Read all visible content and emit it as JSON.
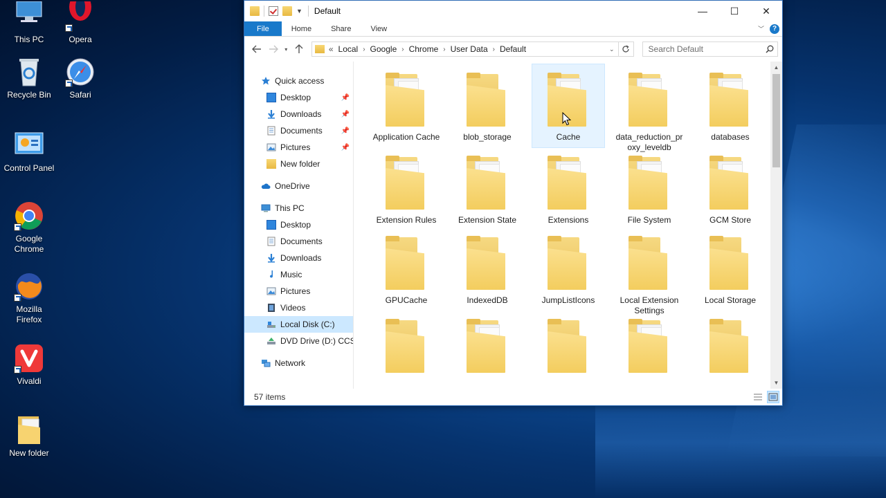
{
  "desktop": {
    "icons": [
      {
        "label": "This PC",
        "icon": "this-pc-icon"
      },
      {
        "label": "Opera",
        "icon": "opera-icon"
      },
      {
        "label": "Recycle Bin",
        "icon": "recycle-bin-icon"
      },
      {
        "label": "Safari",
        "icon": "safari-icon"
      },
      {
        "label": "Control Panel",
        "icon": "control-panel-icon"
      },
      {
        "label": "Google Chrome",
        "icon": "chrome-icon"
      },
      {
        "label": "Mozilla Firefox",
        "icon": "firefox-icon"
      },
      {
        "label": "Vivaldi",
        "icon": "vivaldi-icon"
      },
      {
        "label": "New folder",
        "icon": "folder-icon"
      }
    ]
  },
  "window": {
    "title": "Default",
    "controls": {
      "minimize": "—",
      "maximize": "☐",
      "close": "✕"
    },
    "ribbon": {
      "tabs": [
        "File",
        "Home",
        "Share",
        "View"
      ]
    },
    "address": {
      "lead": "«",
      "crumbs": [
        "Local",
        "Google",
        "Chrome",
        "User Data",
        "Default"
      ]
    },
    "search": {
      "placeholder": "Search Default"
    },
    "nav": {
      "quick_access": "Quick access",
      "quick_items": [
        "Desktop",
        "Downloads",
        "Documents",
        "Pictures",
        "New folder"
      ],
      "onedrive": "OneDrive",
      "this_pc": "This PC",
      "pc_items": [
        "Desktop",
        "Documents",
        "Downloads",
        "Music",
        "Pictures",
        "Videos",
        "Local Disk (C:)",
        "DVD Drive (D:) CCSA"
      ],
      "network": "Network"
    },
    "folders": [
      "Application Cache",
      "blob_storage",
      "Cache",
      "data_reduction_proxy_leveldb",
      "databases",
      "Extension Rules",
      "Extension State",
      "Extensions",
      "File System",
      "GCM Store",
      "GPUCache",
      "IndexedDB",
      "JumpListIcons",
      "Local Extension Settings",
      "Local Storage"
    ],
    "selected_folder": "Cache",
    "status": {
      "item_count": "57 items"
    }
  },
  "colors": {
    "accent": "#1979ca",
    "selection": "#cce8ff",
    "folder": "#f3cd5e"
  }
}
